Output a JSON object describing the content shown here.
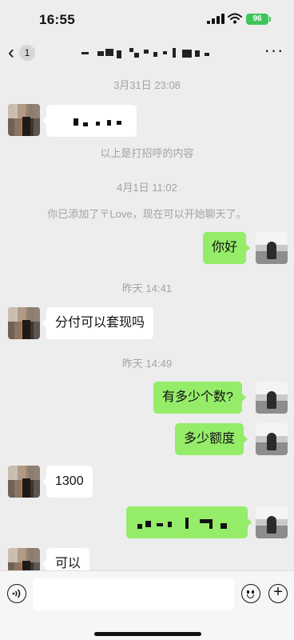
{
  "status_bar": {
    "time": "16:55",
    "battery": "96"
  },
  "nav": {
    "back_count": "1"
  },
  "messages": {
    "ts1": "3月31日 23:08",
    "sys_greeting": "以上是打招呼的内容",
    "ts2": "4月1日 11:02",
    "sys_added": "你已添加了〒Love，现在可以开始聊天了。",
    "hello": "你好",
    "ts3": "昨天 14:41",
    "cash_question": "分付可以套现吗",
    "ts4": "昨天 14:49",
    "how_much": "有多少个数?",
    "amount_question": "多少额度",
    "amount": "1300",
    "ok": "可以"
  },
  "input": {
    "placeholder": ""
  },
  "colors": {
    "background": "#ededed",
    "sent_bubble": "#95ec69",
    "received_bubble": "#ffffff",
    "battery": "#3ec45a"
  }
}
